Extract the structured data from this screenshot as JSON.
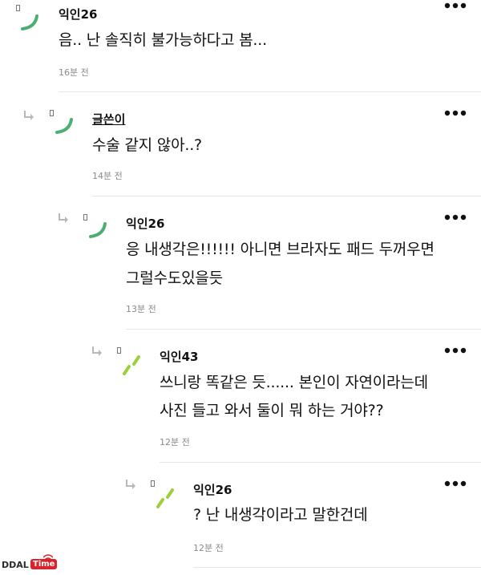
{
  "comments": [
    {
      "nickname": "익인26",
      "lines": [
        "음.. 난 솔직히 불가능하다고 봄..."
      ],
      "time": "16분 전",
      "more_label": "•••",
      "avatar_icon": "green-curve-icon",
      "avatar_color": "#4caf72"
    },
    {
      "nickname": "글쓴이",
      "lines": [
        "수술 같지 않아..?"
      ],
      "time": "14분 전",
      "more_label": "•••",
      "avatar_icon": "green-curve-icon",
      "avatar_color": "#4caf72"
    },
    {
      "nickname": "익인26",
      "lines": [
        "응 내생각은!!!!!! 아니면 브라자도 패드 두꺼우면",
        "그럴수도있을듯"
      ],
      "time": "13분 전",
      "more_label": "•••",
      "avatar_icon": "green-curve-icon",
      "avatar_color": "#4caf72"
    },
    {
      "nickname": "익인43",
      "lines": [
        "쓰니랑 똑같은 듯...... 본인이 자연이라는데",
        "사진 들고 와서 둘이 뭐 하는 거야??"
      ],
      "time": "12분 전",
      "more_label": "•••",
      "avatar_icon": "lime-slash-icon",
      "avatar_color": "#9bcf3c"
    },
    {
      "nickname": "익인26",
      "lines": [
        "? 난 내생각이라고 말한건데"
      ],
      "time": "12분 전",
      "more_label": "•••",
      "avatar_icon": "lime-slash-icon",
      "avatar_color": "#9bcf3c"
    }
  ],
  "logo": {
    "left_text": "DDAL",
    "right_text": "Time",
    "accent_color": "#d9222a"
  }
}
